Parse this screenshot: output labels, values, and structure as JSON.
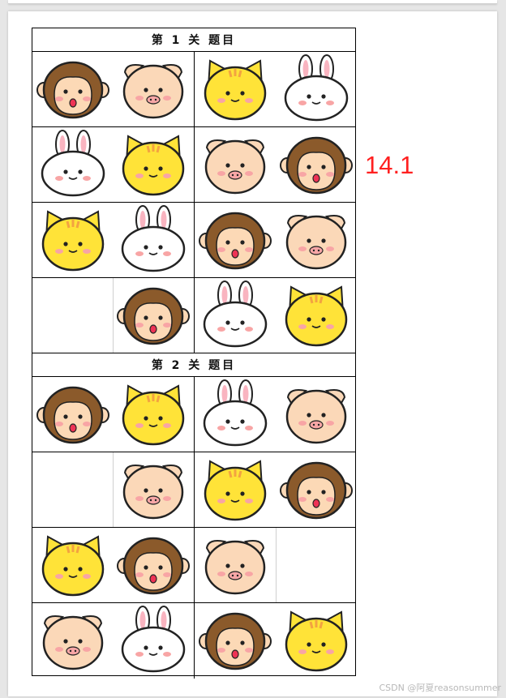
{
  "document": {
    "sections": [
      {
        "title": "第 1 关 题目",
        "rows": [
          [
            "monkey-icon",
            "pig-icon",
            "cat-icon",
            "rabbit-icon"
          ],
          [
            "rabbit-icon",
            "cat-icon",
            "pig-icon",
            "monkey-icon"
          ],
          [
            "cat-icon",
            "rabbit-icon",
            "monkey-icon",
            "pig-icon"
          ],
          [
            "",
            "monkey-icon",
            "rabbit-icon",
            "cat-icon"
          ]
        ]
      },
      {
        "title": "第 2 关 题目",
        "rows": [
          [
            "monkey-icon",
            "cat-icon",
            "rabbit-icon",
            "pig-icon"
          ],
          [
            "",
            "pig-icon",
            "cat-icon",
            "monkey-icon"
          ],
          [
            "cat-icon",
            "monkey-icon",
            "pig-icon",
            ""
          ],
          [
            "pig-icon",
            "rabbit-icon",
            "monkey-icon",
            "cat-icon"
          ]
        ]
      }
    ]
  },
  "annotation": {
    "score": "14.1",
    "color": "#ff2020"
  },
  "watermark": "CSDN @阿夏reasonsummer",
  "colors": {
    "monkey": "#8b5a2b",
    "monkey_face": "#fcd9b6",
    "pig": "#fbd8b8",
    "cat": "#ffe338",
    "rabbit": "#ffffff",
    "blush": "#f8a5a5"
  }
}
